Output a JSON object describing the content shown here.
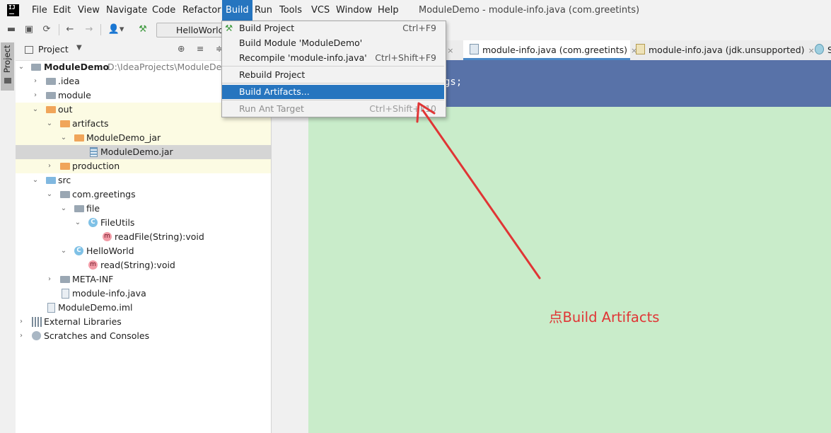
{
  "menubar": {
    "items": [
      "File",
      "Edit",
      "View",
      "Navigate",
      "Code",
      "Refactor",
      "Build",
      "Run",
      "Tools",
      "VCS",
      "Window",
      "Help"
    ],
    "active": "Build",
    "window_title": "ModuleDemo - module-info.java (com.greetints)"
  },
  "toolbar": {
    "run_config": "HelloWorld"
  },
  "stripe": {
    "project_label": "Project"
  },
  "project_panel": {
    "title": "Project",
    "tree": [
      {
        "label": "ModuleDemo",
        "hint": "D:\\IdeaProjects\\ModuleDem",
        "bold": true
      },
      {
        "label": ".idea"
      },
      {
        "label": "module"
      },
      {
        "label": "out"
      },
      {
        "label": "artifacts"
      },
      {
        "label": "ModuleDemo_jar"
      },
      {
        "label": "ModuleDemo.jar"
      },
      {
        "label": "production"
      },
      {
        "label": "src"
      },
      {
        "label": "com.greetings"
      },
      {
        "label": "file"
      },
      {
        "label": "FileUtils"
      },
      {
        "label": "readFile(String):void"
      },
      {
        "label": "HelloWorld"
      },
      {
        "label": "read(String):void"
      },
      {
        "label": "META-INF"
      },
      {
        "label": "module-info.java"
      },
      {
        "label": "ModuleDemo.iml"
      },
      {
        "label": "External Libraries"
      },
      {
        "label": "Scratches and Consoles"
      }
    ]
  },
  "editor": {
    "tabs": [
      {
        "label": "F",
        "close": "×"
      },
      {
        "label": "module-info.java (com.greetints)",
        "close": "×"
      },
      {
        "label": "module-info.java (jdk.unsupported)",
        "close": "×"
      },
      {
        "label": "S"
      }
    ],
    "code_fragment": "gs;"
  },
  "build_menu": {
    "items": [
      {
        "label": "Build Project",
        "shortcut": "Ctrl+F9"
      },
      {
        "label": "Build Module 'ModuleDemo'",
        "shortcut": ""
      },
      {
        "label": "Recompile 'module-info.java'",
        "shortcut": "Ctrl+Shift+F9"
      },
      {
        "label": "Rebuild Project",
        "shortcut": ""
      },
      {
        "label": "Build Artifacts...",
        "shortcut": ""
      },
      {
        "label": "Run Ant Target",
        "shortcut": "Ctrl+Shift+F10"
      }
    ],
    "highlighted": "Build Artifacts..."
  },
  "annotation": {
    "text": "点Build Artifacts",
    "color": "#e03535"
  },
  "colors": {
    "accent": "#2675bf",
    "editor_bg": "#c9ecca",
    "highlight_bg": "#5872a8"
  }
}
